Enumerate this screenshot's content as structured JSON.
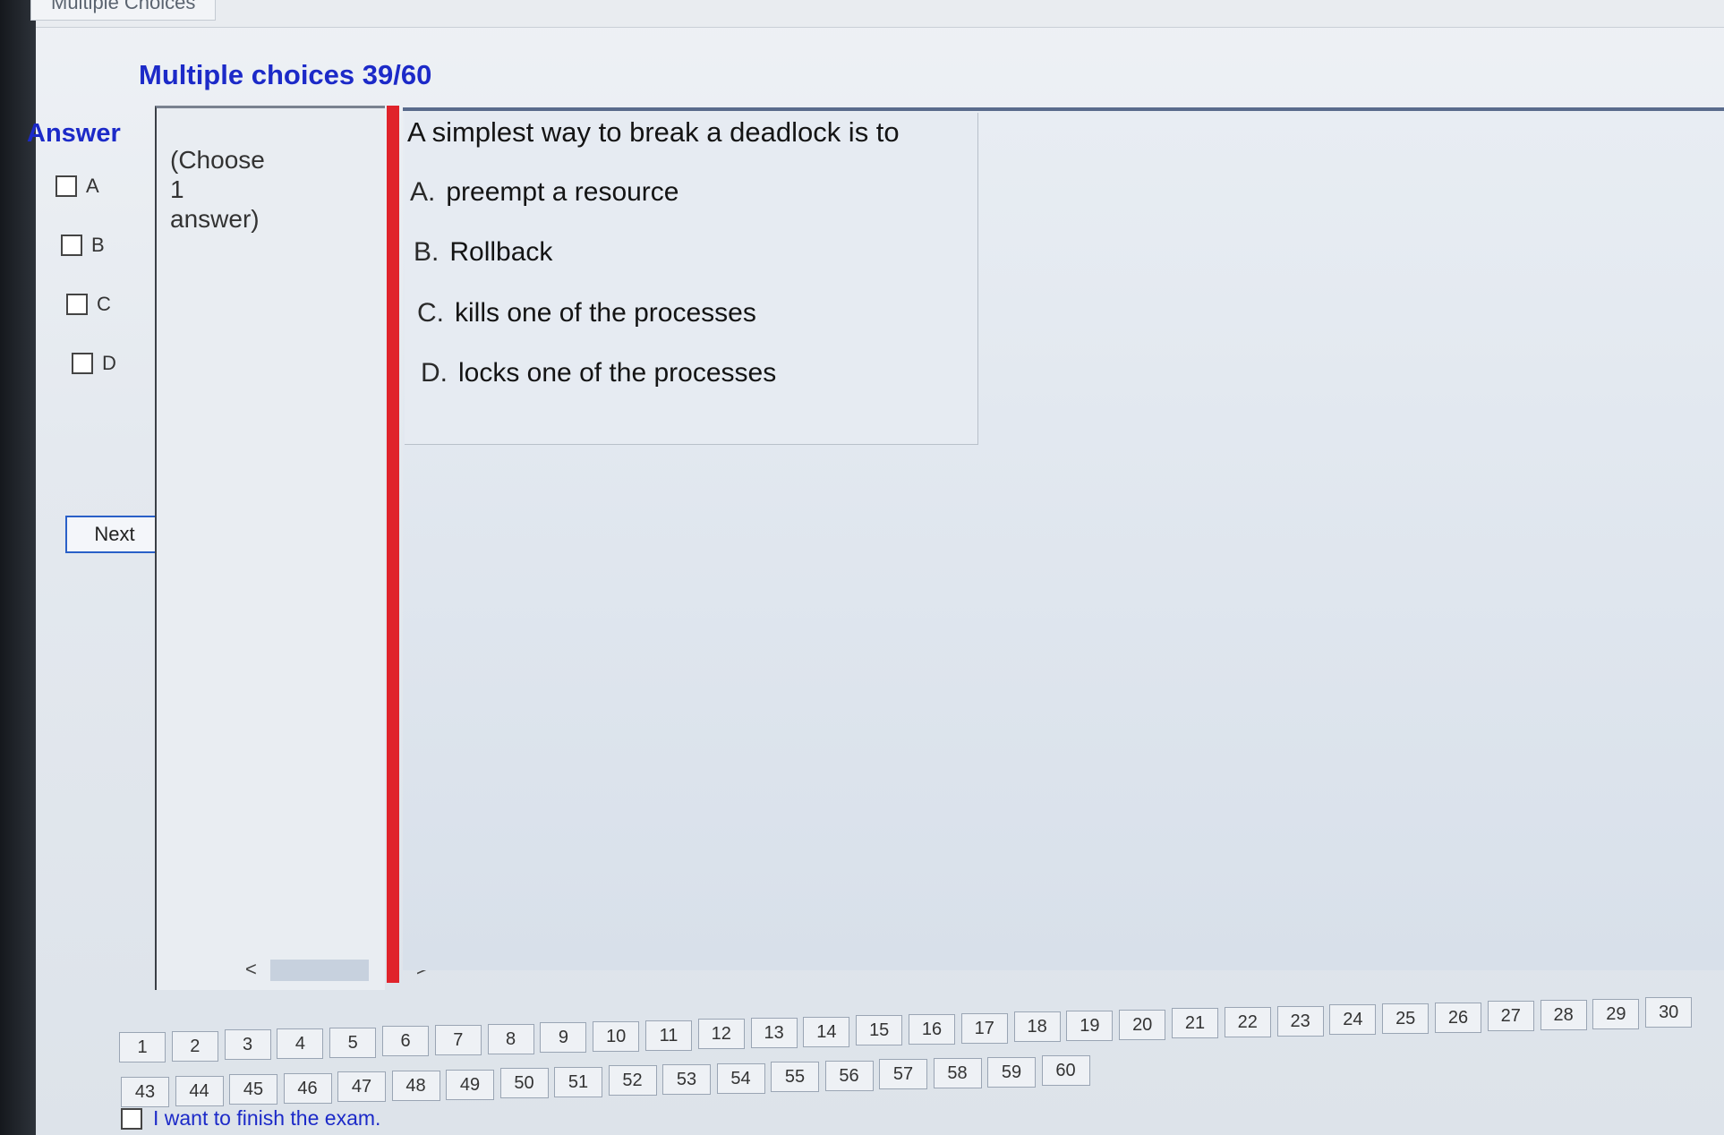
{
  "window_tab": "Multiple Choices",
  "title": "Multiple choices 39/60",
  "answer_label": "Answer",
  "answer_options": [
    "A",
    "B",
    "C",
    "D"
  ],
  "next_label": "Next",
  "hint": {
    "line1": "(Choose",
    "line2": "1",
    "line3": "answer)"
  },
  "scroll": {
    "left": "<",
    "right": ">"
  },
  "question": "A simplest way to break a deadlock is to",
  "choices": [
    {
      "letter": "A.",
      "text": "preempt a resource"
    },
    {
      "letter": "B.",
      "text": "Rollback"
    },
    {
      "letter": "C.",
      "text": "kills one of the processes"
    },
    {
      "letter": "D.",
      "text": "locks one of the processes"
    }
  ],
  "question_nav_row1": [
    "1",
    "2",
    "3",
    "4",
    "5",
    "6",
    "7",
    "8",
    "9",
    "10",
    "11",
    "12",
    "13",
    "14",
    "15",
    "16",
    "17",
    "18",
    "19",
    "20",
    "21",
    "22",
    "23",
    "24",
    "25",
    "26",
    "27",
    "28",
    "29",
    "30"
  ],
  "question_nav_row2": [
    "43",
    "44",
    "45",
    "46",
    "47",
    "48",
    "49",
    "50",
    "51",
    "52",
    "53",
    "54",
    "55",
    "56",
    "57",
    "58",
    "59",
    "60"
  ],
  "finish_label": "I want to finish the exam.",
  "colors": {
    "accent_blue": "#1c2ac8",
    "red_divider": "#e0232b"
  }
}
